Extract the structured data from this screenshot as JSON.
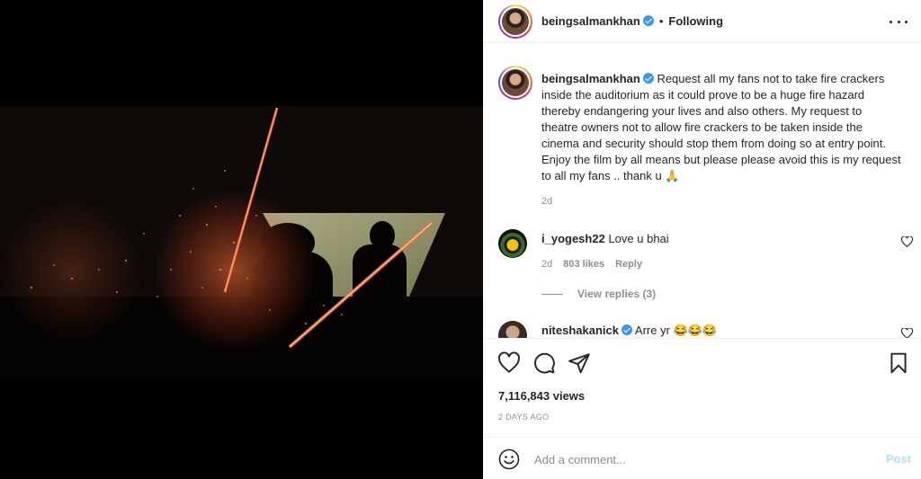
{
  "post": {
    "username": "beingsalmankhan",
    "follow_status": "Following",
    "header_separator": "•"
  },
  "caption": {
    "username": "beingsalmankhan",
    "text": "Request all my fans not to take fire crackers inside the auditorium as it could prove to be a huge fire hazard thereby endangering your lives and also others. My request to theatre owners not to allow fire crackers to be taken inside the cinema and security should stop them from doing so at entry point. Enjoy the film by all means but please please avoid this is my request to all my fans .. thank u 🙏",
    "age": "2d"
  },
  "comments": [
    {
      "username": "i_yogesh22",
      "text": "Love u bhai",
      "age": "2d",
      "likes": "803 likes",
      "reply_label": "Reply",
      "view_replies": "View replies (3)",
      "verified": false
    },
    {
      "username": "niteshakanick",
      "text": "Arre yr 😂😂😂",
      "verified": true
    }
  ],
  "stats": {
    "views": "7,116,843 views",
    "posted_ago": "2 DAYS AGO"
  },
  "add_comment": {
    "placeholder": "Add a comment...",
    "post_label": "Post"
  },
  "icons": {
    "like": "heart-icon",
    "comment": "comment-icon",
    "share": "share-icon",
    "save": "bookmark-icon",
    "more": "more-options-icon",
    "emoji": "emoji-icon",
    "verified": "verified-badge-icon"
  },
  "colors": {
    "verified_blue": "#3897f0",
    "post_button_disabled": "#b2dffc",
    "secondary_text": "#8e8e8e"
  }
}
